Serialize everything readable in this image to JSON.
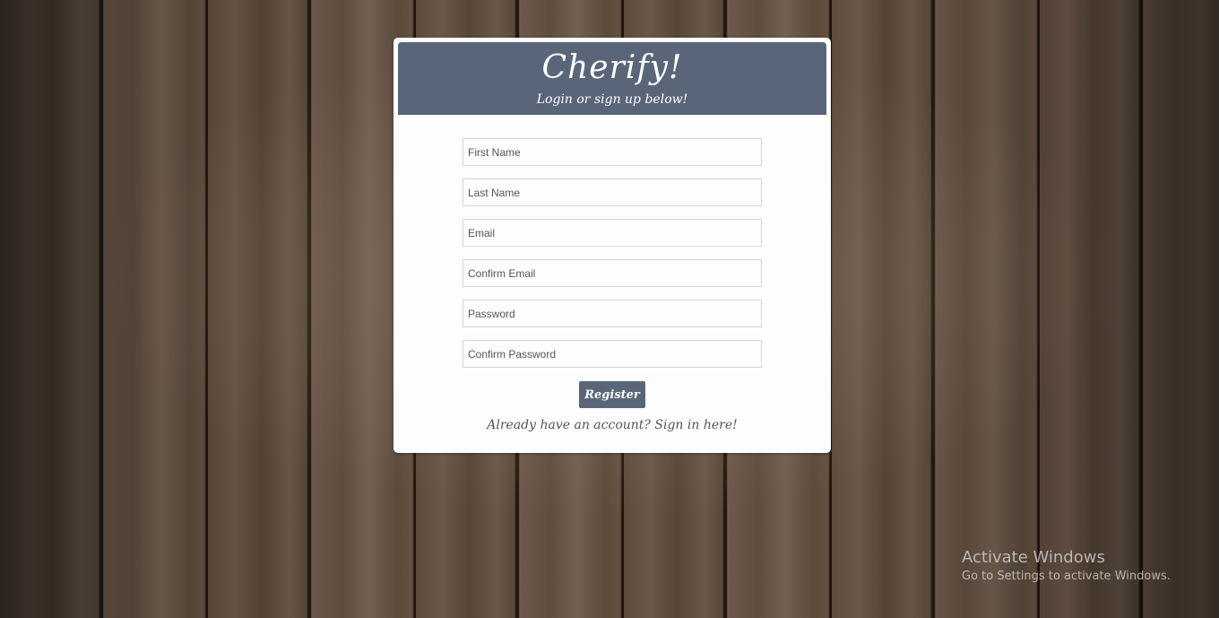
{
  "brand": {
    "title": "Cherify!",
    "subtitle": "Login or sign up below!"
  },
  "form": {
    "fields": [
      {
        "placeholder": "First Name",
        "value": ""
      },
      {
        "placeholder": "Last Name",
        "value": ""
      },
      {
        "placeholder": "Email",
        "value": ""
      },
      {
        "placeholder": "Confirm Email",
        "value": ""
      },
      {
        "placeholder": "Password",
        "value": ""
      },
      {
        "placeholder": "Confirm Password",
        "value": ""
      }
    ],
    "register_label": "Register",
    "signin_link": "Already have an account? Sign in here!"
  },
  "watermark": {
    "title": "Activate Windows",
    "subtitle": "Go to Settings to activate Windows."
  },
  "colors": {
    "header": "#59667a",
    "card": "#fdfdfd",
    "button": "#59667a"
  }
}
